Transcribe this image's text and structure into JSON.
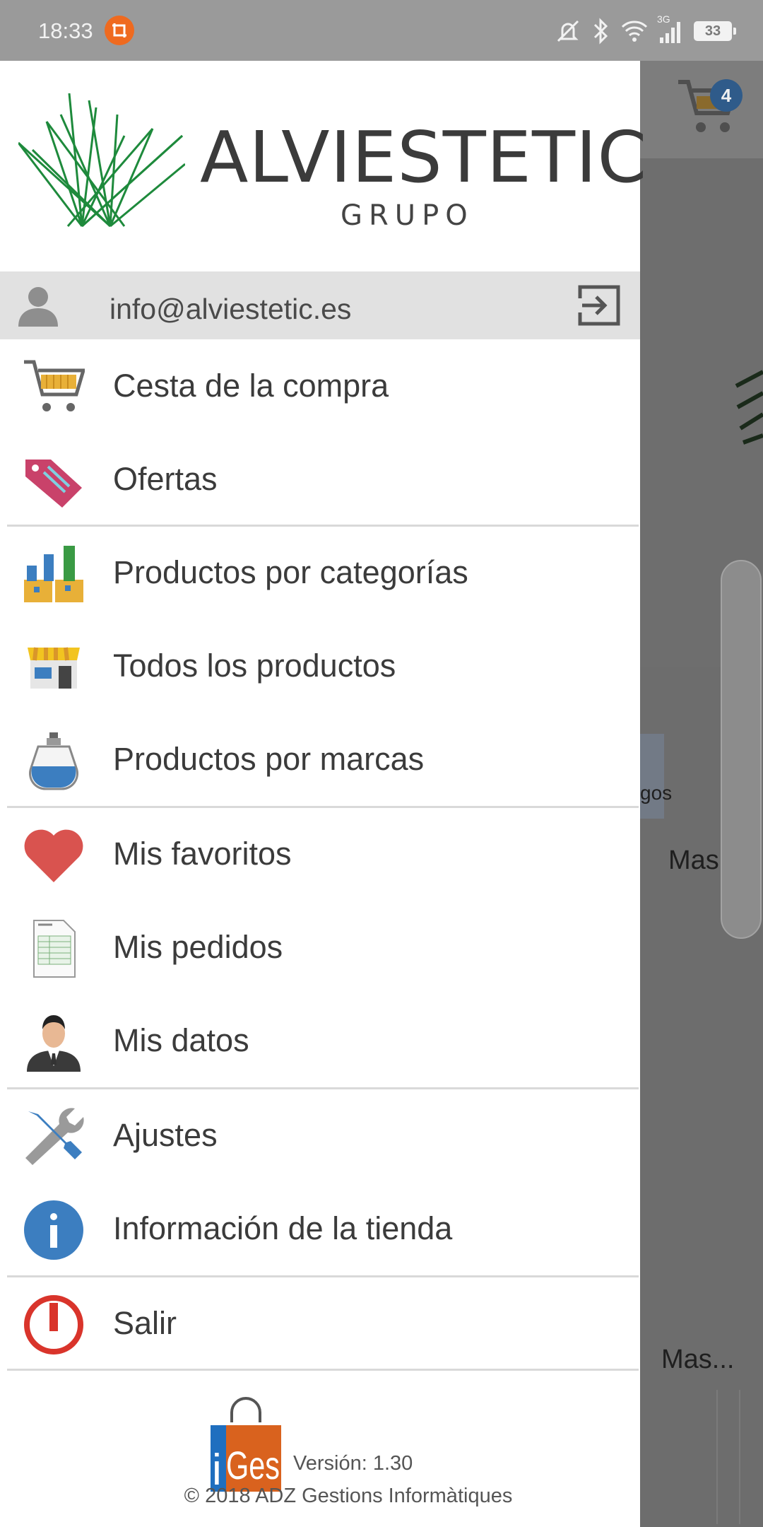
{
  "status_bar": {
    "time": "18:33",
    "battery": "33",
    "network": "3G"
  },
  "background": {
    "cart_count": "4",
    "more_label_1": "Mas...",
    "more_label_2": "Mas...",
    "category_partial": "gos"
  },
  "drawer": {
    "brand_name": "ALVIESTETIC",
    "brand_sub": "GRUPO",
    "account_email": "info@alviestetic.es",
    "menu": [
      {
        "label": "Cesta de la compra",
        "icon": "shopping-cart-icon"
      },
      {
        "label": "Ofertas",
        "icon": "offer-tag-icon"
      },
      {
        "label": "Productos por categorías",
        "icon": "category-boxes-icon"
      },
      {
        "label": "Todos los productos",
        "icon": "store-icon"
      },
      {
        "label": "Productos por marcas",
        "icon": "perfume-bottle-icon"
      },
      {
        "label": "Mis favoritos",
        "icon": "heart-icon"
      },
      {
        "label": "Mis pedidos",
        "icon": "order-document-icon"
      },
      {
        "label": "Mis datos",
        "icon": "user-profile-icon"
      },
      {
        "label": "Ajustes",
        "icon": "wrench-screwdriver-icon"
      },
      {
        "label": "Información de la tienda",
        "icon": "info-icon"
      },
      {
        "label": "Salir",
        "icon": "power-icon"
      }
    ],
    "footer": {
      "app_logo_text": "iGes",
      "version": "Versión: 1.30",
      "copyright": "© 2018 ADZ Gestions Informàtiques"
    }
  },
  "colors": {
    "brand_green": "#1e8a3c",
    "heart_red": "#d9534f",
    "info_blue": "#3c7ec0",
    "power_red": "#d9342b",
    "iges_orange": "#d9621e",
    "iges_blue": "#1f6fbf"
  }
}
